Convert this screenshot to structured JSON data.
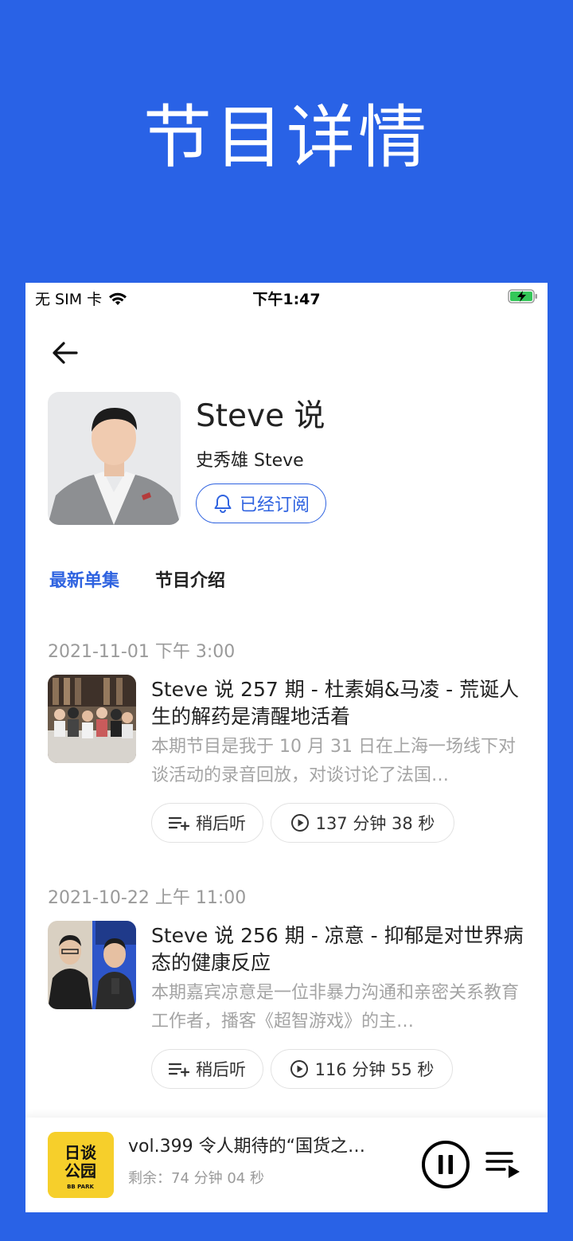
{
  "banner": {
    "title": "节目详情"
  },
  "status_bar": {
    "carrier": "无 SIM 卡",
    "time": "下午1:47"
  },
  "podcast": {
    "title": "Steve 说",
    "author": "史秀雄 Steve",
    "subscribe_label": "已经订阅"
  },
  "tabs": [
    {
      "label": "最新单集",
      "active": true
    },
    {
      "label": "节目介绍",
      "active": false
    }
  ],
  "episodes": [
    {
      "date": "2021-11-01 下午 3:00",
      "title": "Steve 说 257 期 - 杜素娟&马凌 - 荒诞人生的解药是清醒地活着",
      "description": "本期节目是我于 10 月 31 日在上海一场线下对谈活动的录音回放，对谈讨论了法国…",
      "later_label": "稍后听",
      "duration": "137 分钟 38 秒"
    },
    {
      "date": "2021-10-22 上午 11:00",
      "title": "Steve 说 256 期 - 凉意 - 抑郁是对世界病态的健康反应",
      "description": "本期嘉宾凉意是一位非暴力沟通和亲密关系教育工作者，播客《超智游戏》的主…",
      "later_label": "稍后听",
      "duration": "116 分钟 55 秒"
    }
  ],
  "player": {
    "title": "vol.399 令人期待的“国货之…",
    "remaining": "剩余：74 分钟 04 秒",
    "art_text_line1": "日谈",
    "art_text_line2": "公园",
    "art_text_sub": "BB PARK"
  },
  "colors": {
    "accent": "#2f63e0",
    "banner_bg": "#2962e6",
    "player_art_bg": "#f6cf2b"
  }
}
